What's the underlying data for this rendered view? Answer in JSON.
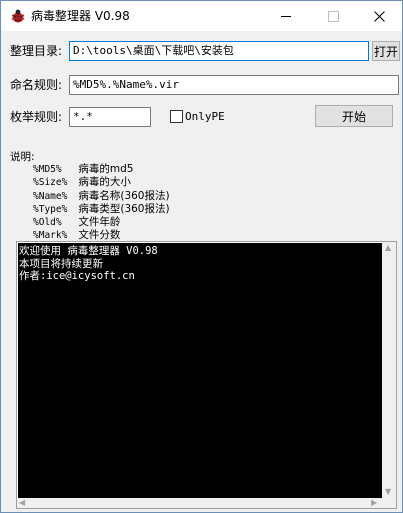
{
  "window": {
    "title": "病毒整理器 V0.98",
    "icon": "ladybug-icon"
  },
  "form": {
    "dir_label": "整理目录:",
    "dir_value": "D:\\tools\\桌面\\下载吧\\安装包",
    "open_button": "打开",
    "naming_label": "命名规则:",
    "naming_value": "%MD5%.%Name%.vir",
    "enum_label": "枚举规则:",
    "enum_value": "*.*",
    "onlype_label": "OnlyPE",
    "start_button": "开始"
  },
  "help": {
    "title": "说明:",
    "rows": [
      {
        "token": "%MD5%",
        "desc": "病毒的md5"
      },
      {
        "token": "%Size%",
        "desc": "病毒的大小"
      },
      {
        "token": "%Name%",
        "desc": "病毒名称(360报法)"
      },
      {
        "token": "%Type%",
        "desc": "病毒类型(360报法)"
      },
      {
        "token": "%Old%",
        "desc": "文件年龄"
      },
      {
        "token": "%Mark%",
        "desc": "文件分数"
      }
    ]
  },
  "console": {
    "lines": [
      "欢迎使用 病毒整理器 V0.98",
      "本项目将持续更新",
      "作者:ice@icysoft.cn"
    ]
  },
  "colors": {
    "accent": "#0078d7",
    "console_bg": "#000000",
    "console_fg": "#ffffff"
  }
}
